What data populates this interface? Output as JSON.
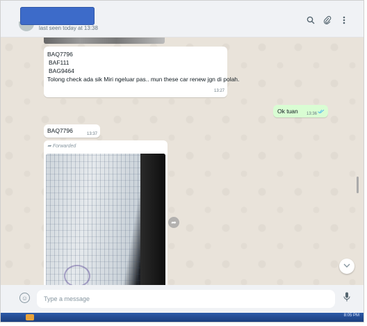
{
  "header": {
    "last_seen": "last seen today at 13:38",
    "icons": [
      "search-icon",
      "paperclip-icon",
      "menu-icon"
    ]
  },
  "messages": [
    {
      "direction": "incoming",
      "lines": [
        "BAQ7796",
        "BAF111",
        "BAG9464",
        "Tolong check ada sik Miri ngeluar pas.. mun these car renew jgn di polah."
      ],
      "time": "13:27"
    },
    {
      "direction": "outgoing",
      "text": "Ok tuan",
      "time": "13:36",
      "status": "read"
    },
    {
      "direction": "incoming",
      "text": "BAQ7796",
      "time": "13:37"
    },
    {
      "direction": "incoming",
      "forwarded_label": "Forwarded",
      "type": "image"
    }
  ],
  "composer": {
    "placeholder": "Type a message"
  },
  "taskbar": {
    "clock": "8:05 PM"
  },
  "colors": {
    "chat_bg": "#e9e3da",
    "outgoing_bubble": "#d9fdd3",
    "header_bg": "#f0f2f5",
    "redaction": "#3d6bc9"
  }
}
